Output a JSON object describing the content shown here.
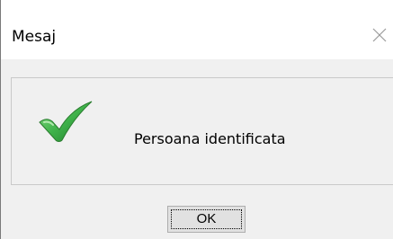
{
  "window": {
    "title": "Mesaj",
    "close_icon": "close-icon",
    "colors": {
      "titlebar": "#ffffff",
      "body": "#f0f0f0",
      "check_green": "#35a93b"
    }
  },
  "message": {
    "icon": "checkmark-icon",
    "text": "Persoana identificata"
  },
  "buttons": {
    "ok_label": "OK"
  }
}
